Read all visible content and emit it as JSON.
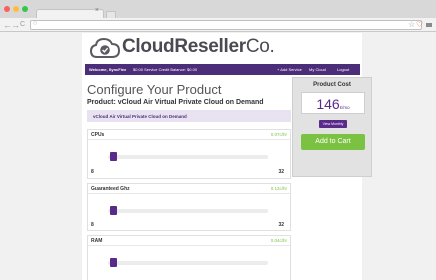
{
  "browser": {
    "tab_close": "×",
    "nav_back": "←",
    "nav_forward": "→",
    "nav_reload": "C",
    "omnibox_icon": "○",
    "ext_star": "☆",
    "ext_shield": "♡"
  },
  "brand": {
    "name": "CloudReseller",
    "suffix": "Co."
  },
  "topbar": {
    "welcome": "Welcome, SyncFlex",
    "credit": "$0.00 Service Credit Balance: $0.00",
    "add_service": "+ Add Service",
    "my_cloud": "My Cloud",
    "logout": "Logout"
  },
  "main": {
    "title": "Configure Your Product",
    "product": "Product: vCloud Air Virtual Private Cloud on Demand",
    "product_tag": "vCloud Air Virtual Private Cloud on Demand"
  },
  "sections": [
    {
      "label": "CPUs",
      "price": "0.07c/hr",
      "min": "8",
      "max": "32",
      "level": 0.0
    },
    {
      "label": "Guaranteed Ghz",
      "price": "0.12c/hr",
      "min": "8",
      "max": "32",
      "level": 0.0
    },
    {
      "label": "RAM",
      "price": "0.04c/hr",
      "level": 0.0
    }
  ],
  "cost": {
    "title": "Product Cost",
    "price": "146",
    "per": "¢/mo",
    "monthly_btn": "View Monthly",
    "cart_btn": "Add to Cart"
  },
  "colors": {
    "accent": "#5a2a8a",
    "bar": "#4b2d7a",
    "green": "#7cc242"
  }
}
